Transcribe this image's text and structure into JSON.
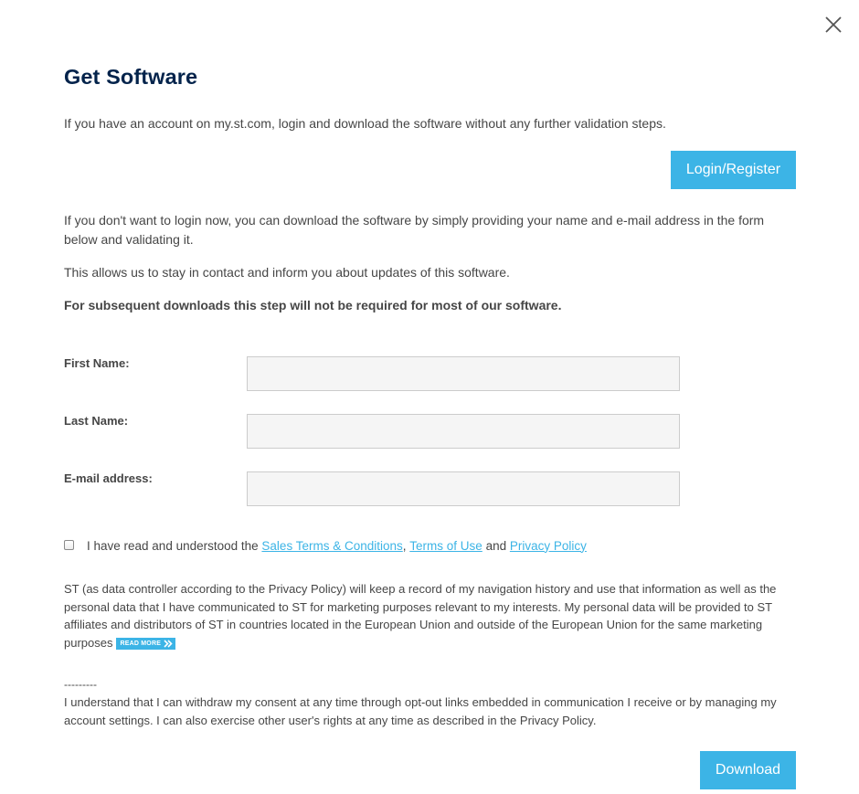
{
  "dialog": {
    "title": "Get Software",
    "close_icon": "close-icon"
  },
  "intro": {
    "text": "If you have an account on my.st.com, login and download the software without any further validation steps.",
    "login_button": "Login/Register"
  },
  "no_login": {
    "text": "If you don't want to login now, you can download the software by simply providing your name and e-mail address in the form below and validating it.",
    "contact_text": "This allows us to stay in contact and inform you about updates of this software.",
    "subsequent_text": "For subsequent downloads this step will not be required for most of our software."
  },
  "form": {
    "first_name_label": "First Name:",
    "first_name_value": "",
    "last_name_label": "Last Name:",
    "last_name_value": "",
    "email_label": "E-mail address:",
    "email_value": ""
  },
  "consent": {
    "checked": false,
    "prefix": "I have read and understood the",
    "sales_terms_link": "Sales Terms & Conditions",
    "comma": ",",
    "terms_of_use_link": "Terms of Use",
    "and": "and",
    "privacy_policy_link": "Privacy Policy"
  },
  "controller": {
    "text": "ST (as data controller according to the Privacy Policy) will keep a record of my navigation history and use that information as well as the personal data that I have communicated to ST for marketing purposes relevant to my interests. My personal data will be provided to ST affiliates and distributors of ST in countries located in the European Union and outside of the European Union for the same marketing purposes",
    "read_more": "READ MORE"
  },
  "withdraw": {
    "dashes": "---------",
    "text": "I understand that I can withdraw my consent at any time through opt-out links embedded in communication I receive or by managing my account settings. I can also exercise other user's rights at any time as described in the Privacy Policy."
  },
  "download_button": "Download",
  "colors": {
    "accent": "#3cb4e6",
    "title": "#03234b",
    "text": "#464646",
    "field_bg": "#f5f5f5",
    "field_border": "#cccccc"
  }
}
